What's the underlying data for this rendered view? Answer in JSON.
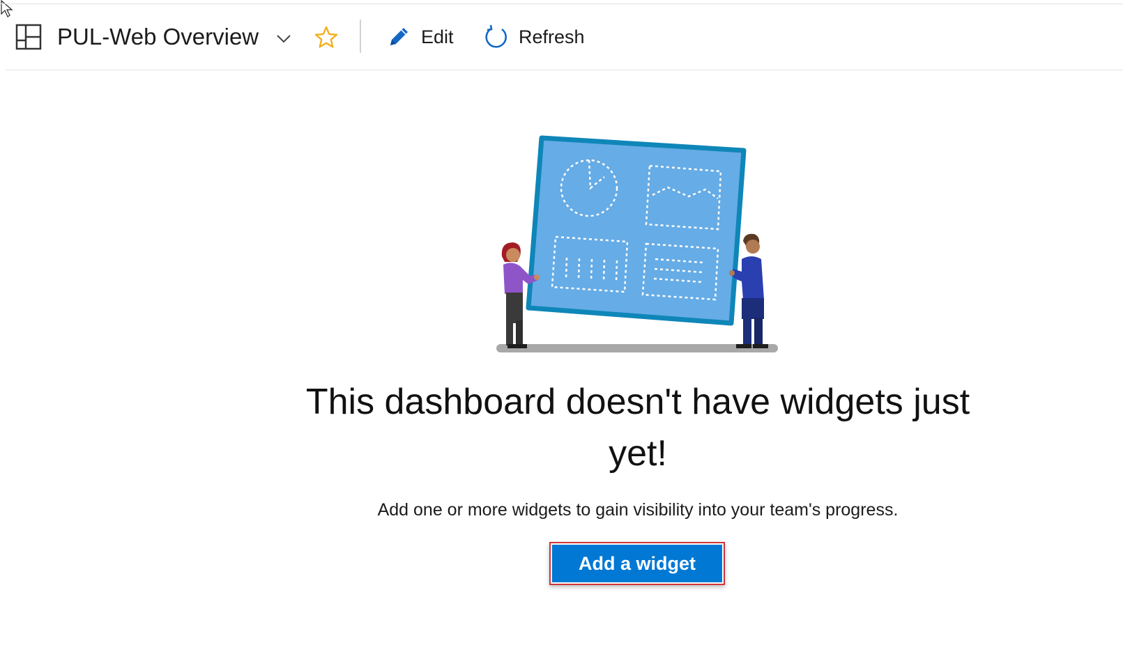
{
  "header": {
    "title": "PUL-Web Overview",
    "icons": {
      "dashboard": "dashboard-grid-icon",
      "chevron": "chevron-down-icon",
      "favorite": "star-icon"
    },
    "actions": {
      "edit_label": "Edit",
      "refresh_label": "Refresh"
    }
  },
  "empty_state": {
    "title": "This dashboard doesn't have widgets just yet!",
    "subtitle": "Add one or more widgets to gain visibility into your team's progress.",
    "button_label": "Add a widget"
  },
  "colors": {
    "accent": "#0078d4",
    "favorite_star": "#f2b01e",
    "highlight_border": "#d13438",
    "board_fill": "#66ace6",
    "board_frame": "#0f86b8"
  }
}
